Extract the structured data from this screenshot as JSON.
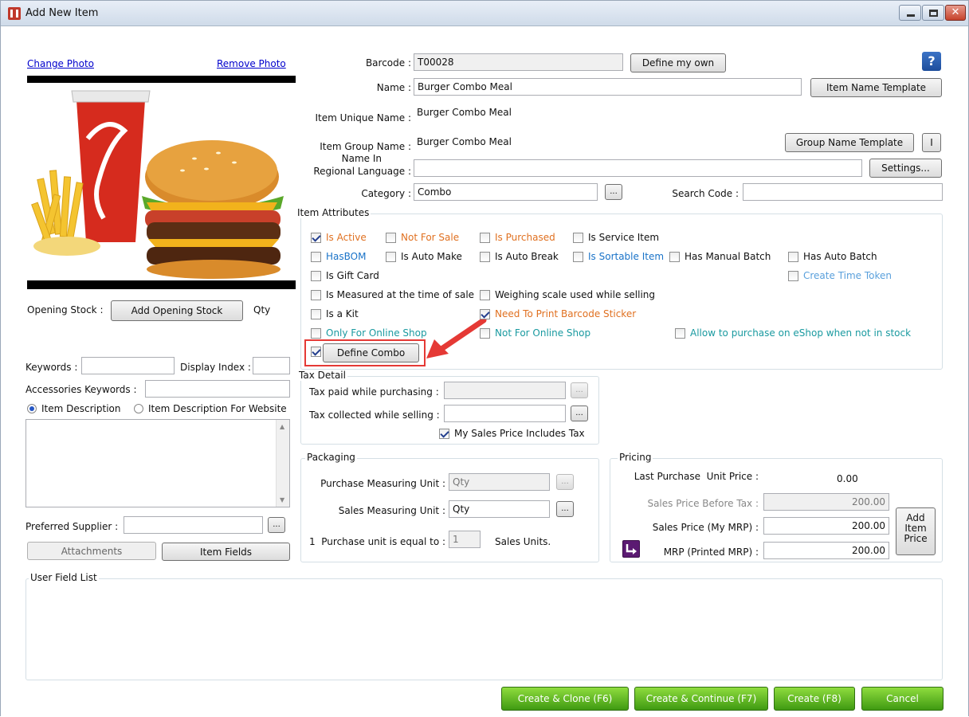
{
  "window": {
    "title": "Add New Item",
    "help": "?"
  },
  "photo": {
    "change": "Change Photo",
    "remove": "Remove Photo",
    "image_brand": "Coca-Cola"
  },
  "left": {
    "opening_stock_label": "Opening Stock :",
    "add_opening_stock": "Add Opening Stock",
    "qty": "Qty",
    "keywords_label": "Keywords :",
    "keywords_value": "",
    "display_index_label": "Display Index :",
    "display_index_value": "",
    "accessories_label": "Accessories Keywords :",
    "accessories_value": "",
    "desc_radio": "Item Description",
    "desc_web_radio": "Item Description For Website",
    "preferred_supplier_label": "Preferred Supplier :",
    "preferred_supplier_value": "",
    "attachments": "Attachments",
    "item_fields": "Item Fields"
  },
  "form": {
    "barcode_label": "Barcode :",
    "barcode_value": "T00028",
    "define_my_own": "Define my own",
    "name_label": "Name :",
    "name_value": "Burger Combo Meal",
    "item_name_template": "Item Name Template",
    "unique_label": "Item Unique Name :",
    "unique_value": "Burger Combo Meal",
    "group_label": "Item Group Name :",
    "group_value": "Burger Combo Meal",
    "group_name_template": "Group Name Template",
    "group_i": "I",
    "regional_label_1": "Name In",
    "regional_label_2": "Regional Language :",
    "regional_value": "",
    "settings": "Settings...",
    "category_label": "Category :",
    "category_value": "Combo",
    "ellipsis": "...",
    "search_code_label": "Search Code :",
    "search_code_value": ""
  },
  "attributes": {
    "title": "Item Attributes",
    "items": [
      {
        "label": "Is Active",
        "checked": true,
        "color": "#e07020"
      },
      {
        "label": "Not For Sale",
        "checked": false,
        "color": "#e07020"
      },
      {
        "label": "Is Purchased",
        "checked": false,
        "color": "#e07020"
      },
      {
        "label": "Is Service Item",
        "checked": false,
        "color": "#111111"
      },
      {
        "label": "HasBOM",
        "checked": false,
        "color": "#1a73c8"
      },
      {
        "label": "Is Auto Make",
        "checked": false,
        "color": "#111111"
      },
      {
        "label": "Is Auto Break",
        "checked": false,
        "color": "#111111"
      },
      {
        "label": "Is Sortable Item",
        "checked": false,
        "color": "#1a73c8"
      },
      {
        "label": "Has Manual Batch",
        "checked": false,
        "color": "#111111"
      },
      {
        "label": "Has Auto Batch",
        "checked": false,
        "color": "#111111"
      },
      {
        "label": "Is Gift Card",
        "checked": false,
        "color": "#111111"
      },
      {
        "label": "Create Time Token",
        "checked": false,
        "color": "#5aa0dc"
      },
      {
        "label": "Is Measured at the time of sale",
        "checked": false,
        "color": "#111111"
      },
      {
        "label": "Weighing scale used while selling",
        "checked": false,
        "color": "#111111"
      },
      {
        "label": "Is a Kit",
        "checked": false,
        "color": "#111111"
      },
      {
        "label": "Need To Print Barcode Sticker",
        "checked": true,
        "color": "#e07020"
      },
      {
        "label": "Only For Online Shop",
        "checked": false,
        "color": "#1a9aa0"
      },
      {
        "label": "Not For Online Shop",
        "checked": false,
        "color": "#1a9aa0"
      },
      {
        "label": "Allow to purchase on eShop when not in stock",
        "checked": false,
        "color": "#1a9aa0"
      }
    ],
    "combo_checked": true,
    "define_combo": "Define Combo"
  },
  "tax": {
    "title": "Tax Detail",
    "paid_label": "Tax paid while purchasing :",
    "paid_value": "",
    "collected_label": "Tax collected while selling :",
    "collected_value": "",
    "includes_tax": "My Sales Price Includes Tax",
    "includes_tax_checked": true
  },
  "packaging": {
    "title": "Packaging",
    "purchase_label": "Purchase Measuring Unit :",
    "purchase_value": "Qty",
    "sales_label": "Sales Measuring Unit :",
    "sales_value": "Qty",
    "equal_label": "1  Purchase unit is equal to :",
    "equal_value": "1",
    "sales_units": "Sales Units."
  },
  "pricing": {
    "title": "Pricing",
    "last_label": "Last Purchase  Unit Price :",
    "last_value": "0.00",
    "before_tax_label": "Sales Price Before Tax :",
    "before_tax_value": "200.00",
    "mrp_label": "Sales Price (My MRP) :",
    "mrp_value": "200.00",
    "printed_label": "MRP (Printed MRP) :",
    "printed_value": "200.00",
    "add_price_1": "Add",
    "add_price_2": "Item",
    "add_price_3": "Price"
  },
  "user_fields": {
    "title": "User Field List"
  },
  "footer": {
    "clone": "Create & Clone  (F6)",
    "continue": "Create & Continue (F7)",
    "create": "Create (F8)",
    "cancel": "Cancel"
  },
  "colors": {
    "accent_red": "#e53935",
    "green_button": "#4caf1a"
  }
}
